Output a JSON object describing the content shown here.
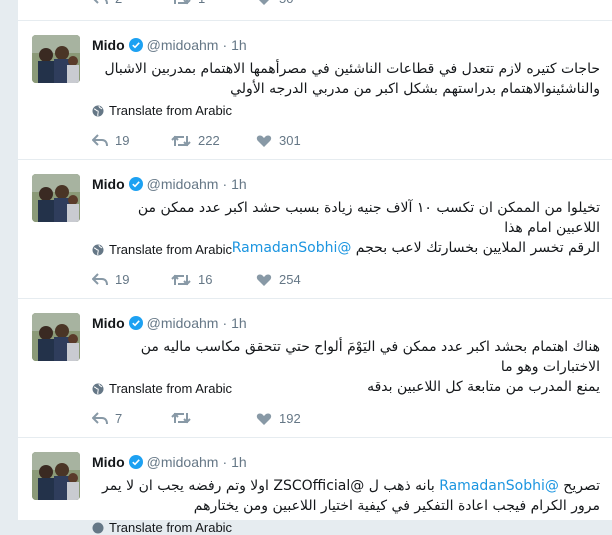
{
  "colors": {
    "accent": "#1b95e0",
    "muted": "#657786",
    "text": "#14171a"
  },
  "top_counts": {
    "replies": "2",
    "retweets": "1",
    "likes": "50"
  },
  "tweets": [
    {
      "name": "Mido",
      "handle": "@midoahm",
      "sep": "·",
      "time": "1h",
      "lines": [
        {
          "pre": "حاجات كتيره لازم تتعدل في قطاعات الناشئين في مصرأهمها الاهتمام بمدربين الاشبال",
          "mention": "",
          "post": ""
        },
        {
          "pre": "والناشئينوالاهتمام بدراستهم بشكل اكبر من مدربي الدرجه الأولي",
          "mention": "",
          "post": ""
        }
      ],
      "translate": "Translate from Arabic",
      "replies": "19",
      "retweets": "222",
      "likes": "301"
    },
    {
      "name": "Mido",
      "handle": "@midoahm",
      "sep": "·",
      "time": "1h",
      "lines": [
        {
          "pre": "تخيلوا من الممكن ان تكسب ١٠ آلاف جنيه زيادة بسبب حشد اكبر عدد ممكن من اللاعبين امام هذا",
          "mention": "",
          "post": ""
        },
        {
          "pre": "الرقم تخسر الملايين بخسارتك لاعب بحجم ",
          "mention": "@RamadanSobhi",
          "post": ""
        }
      ],
      "translate": "Translate from Arabic",
      "replies": "19",
      "retweets": "16",
      "likes": "254"
    },
    {
      "name": "Mido",
      "handle": "@midoahm",
      "sep": "·",
      "time": "1h",
      "lines": [
        {
          "pre": "هناك اهتمام بحشد اكبر عدد ممكن في اليَوْمَ ألواح حتي تتحقق مكاسب ماليه من الاختبارات وهو ما",
          "mention": "",
          "post": ""
        },
        {
          "pre": "يمنع المدرب من متابعة كل اللاعبين بدقه",
          "mention": "",
          "post": ""
        }
      ],
      "translate": "Translate from Arabic",
      "replies": "7",
      "retweets": "",
      "likes": "192"
    },
    {
      "name": "Mido",
      "handle": "@midoahm",
      "sep": "·",
      "time": "1h",
      "lines": [
        {
          "pre": "تصريح ",
          "mention": "@RamadanSobhi",
          "post": " بانه ذهب ل @ZSCOfficial اولا وتم رفضه يجب ان لا يمر"
        },
        {
          "pre": "مرور الكرام فيجب اعادة التفكير في كيفية اختيار اللاعبين ومن يختارهم",
          "mention": "",
          "post": ""
        }
      ],
      "translate": "Translate from Arabic",
      "replies": "",
      "retweets": "",
      "likes": ""
    }
  ],
  "icons": {
    "reply": "reply-icon",
    "retweet": "retweet-icon",
    "like": "heart-icon",
    "globe": "globe-icon",
    "verified": "verified-badge-icon"
  }
}
